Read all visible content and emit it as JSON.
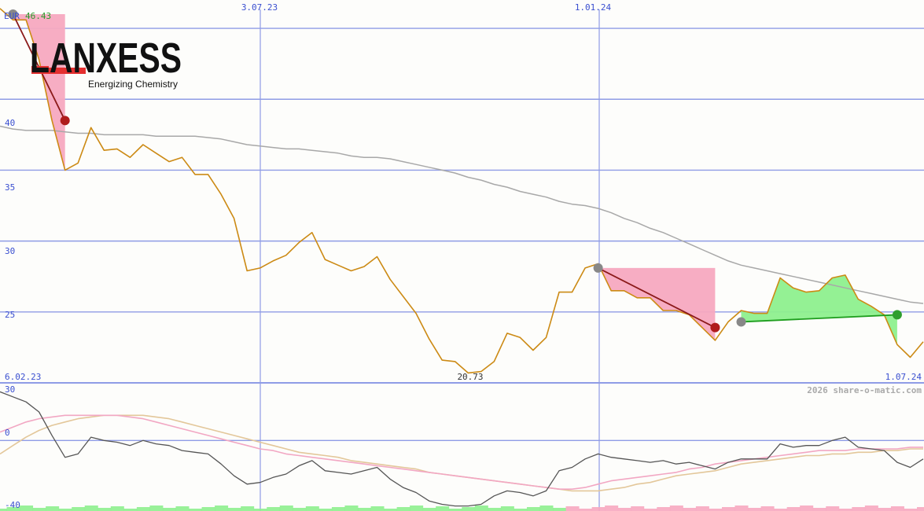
{
  "header": {
    "currency": "EUR",
    "last_price": "46.43"
  },
  "logo": {
    "name": "LANXESS",
    "tagline": "Energizing Chemistry"
  },
  "credit": "2026 share-o-matic.com",
  "colors": {
    "price": "#cc8a14",
    "sma": "#a8a8a8",
    "grid": "#8f9ce6",
    "axis_label": "#3a4fd0",
    "loss": "#f7a9c0",
    "gain": "#8ef08e",
    "loss_line": "#8b1a1a",
    "gain_line": "#1f9e1f",
    "osc_main": "#555555",
    "osc_pink": "#f2a7c3",
    "osc_tan": "#e3c79a"
  },
  "chart_data": [
    {
      "type": "line",
      "title": "",
      "x_ticks_top": [
        "3.07.23",
        "1.01.24"
      ],
      "x_ticks_bottom": [
        "6.02.23",
        "1.07.24"
      ],
      "y_ticks": [
        "40",
        "35",
        "30",
        "25"
      ],
      "ylim": [
        20,
        47
      ],
      "low_label": "20.73",
      "series": [
        {
          "values": [
            46.4,
            45.6,
            45.6,
            42.8,
            38.5,
            35.0,
            35.5,
            38.0,
            36.4,
            36.5,
            35.9,
            36.8,
            36.2,
            35.6,
            35.9,
            34.7,
            34.7,
            33.3,
            31.6,
            27.9,
            28.1,
            28.6,
            29.0,
            29.9,
            30.6,
            28.7,
            28.3,
            27.9,
            28.2,
            28.9,
            27.3,
            26.1,
            24.9,
            23.1,
            21.6,
            21.5,
            20.7,
            20.8,
            21.5,
            23.5,
            23.2,
            22.3,
            23.2,
            26.4,
            26.4,
            28.1,
            28.4,
            26.5,
            26.5,
            26.0,
            26.0,
            25.1,
            25.1,
            24.8,
            23.9,
            23.0,
            24.3,
            25.1,
            24.9,
            24.9,
            27.4,
            26.7,
            26.4,
            26.5,
            27.4,
            27.6,
            25.9,
            25.4,
            24.8,
            22.7,
            21.8,
            22.9
          ]
        },
        {
          "values": [
            38.1,
            37.9,
            37.8,
            37.8,
            37.8,
            37.7,
            37.6,
            37.6,
            37.5,
            37.5,
            37.5,
            37.5,
            37.4,
            37.4,
            37.4,
            37.4,
            37.3,
            37.2,
            37.0,
            36.8,
            36.7,
            36.6,
            36.5,
            36.5,
            36.4,
            36.3,
            36.2,
            36.0,
            35.9,
            35.9,
            35.8,
            35.6,
            35.4,
            35.2,
            35.0,
            34.8,
            34.5,
            34.3,
            34.0,
            33.8,
            33.5,
            33.3,
            33.1,
            32.8,
            32.6,
            32.5,
            32.3,
            32.0,
            31.6,
            31.3,
            30.9,
            30.6,
            30.2,
            29.8,
            29.4,
            29.0,
            28.6,
            28.3,
            28.1,
            27.9,
            27.7,
            27.5,
            27.3,
            27.1,
            26.9,
            26.7,
            26.5,
            26.3,
            26.1,
            25.9,
            25.7,
            25.6
          ]
        }
      ],
      "trades": [
        {
          "kind": "loss",
          "entry_index": 1,
          "exit_index": 5,
          "entry": 46.0,
          "exit": 38.5
        },
        {
          "kind": "loss",
          "entry_index": 46,
          "exit_index": 55,
          "entry": 28.1,
          "exit": 23.9
        },
        {
          "kind": "gain",
          "entry_index": 57,
          "exit_index": 69,
          "entry": 24.3,
          "exit": 24.8
        }
      ]
    },
    {
      "type": "line",
      "title": "",
      "y_ticks": [
        "30",
        "0",
        "-40"
      ],
      "ylim": [
        -42,
        32
      ],
      "series": [
        {
          "values": [
            29,
            26,
            23,
            17,
            3,
            -10,
            -8,
            2,
            0,
            -1,
            -3,
            0,
            -2,
            -3,
            -6,
            -7,
            -8,
            -14,
            -21,
            -26,
            -25,
            -22,
            -20,
            -15,
            -12,
            -18,
            -19,
            -20,
            -18,
            -16,
            -23,
            -28,
            -31,
            -36,
            -38,
            -39,
            -39,
            -38,
            -33,
            -30,
            -31,
            -33,
            -30,
            -18,
            -16,
            -11,
            -8,
            -10,
            -11,
            -12,
            -13,
            -12,
            -14,
            -13,
            -15,
            -17,
            -13,
            -11,
            -11,
            -11,
            -2,
            -4,
            -3,
            -3,
            0,
            2,
            -4,
            -5,
            -6,
            -13,
            -16,
            -11
          ]
        },
        {
          "values": [
            5,
            8,
            11,
            13,
            14,
            15,
            15,
            15,
            15,
            15,
            14,
            13,
            11,
            9,
            7,
            5,
            3,
            1,
            -1,
            -3,
            -5,
            -6,
            -8,
            -9,
            -10,
            -11,
            -12,
            -13,
            -14,
            -15,
            -16,
            -17,
            -18,
            -19,
            -20,
            -21,
            -22,
            -23,
            -24,
            -25,
            -26,
            -27,
            -28,
            -29,
            -29,
            -28,
            -26,
            -24,
            -23,
            -22,
            -21,
            -20,
            -19,
            -17,
            -16,
            -14,
            -13,
            -12,
            -11,
            -10,
            -9,
            -8,
            -7,
            -6,
            -6,
            -6,
            -5,
            -5,
            -5,
            -5,
            -4,
            -4
          ]
        },
        {
          "values": [
            -8,
            -3,
            2,
            6,
            9,
            11,
            13,
            14,
            15,
            15,
            15,
            15,
            14,
            13,
            11,
            9,
            7,
            5,
            3,
            1,
            -1,
            -3,
            -5,
            -7,
            -8,
            -9,
            -10,
            -12,
            -13,
            -14,
            -15,
            -16,
            -17,
            -19,
            -20,
            -21,
            -22,
            -23,
            -24,
            -25,
            -26,
            -27,
            -28,
            -29,
            -30,
            -30,
            -30,
            -29,
            -28,
            -26,
            -25,
            -23,
            -21,
            -20,
            -19,
            -18,
            -16,
            -14,
            -13,
            -12,
            -11,
            -10,
            -9,
            -9,
            -8,
            -8,
            -7,
            -7,
            -6,
            -6,
            -5,
            -5
          ]
        }
      ]
    }
  ]
}
